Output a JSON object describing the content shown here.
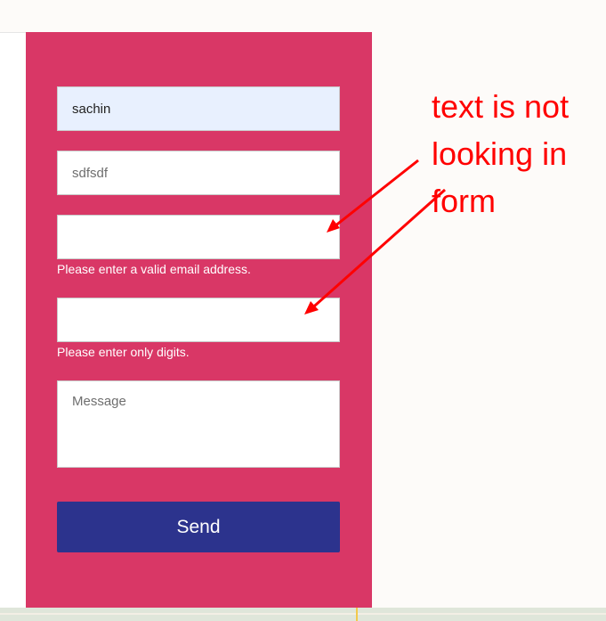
{
  "form": {
    "name_value": "sachin",
    "second_value": "sdfsdf",
    "email_value": "",
    "email_error": "Please enter a valid email address.",
    "phone_value": "",
    "phone_error": "Please enter only digits.",
    "message_placeholder": "Message",
    "send_label": "Send"
  },
  "annotation": {
    "line1": "text is not",
    "line2": "looking in",
    "line3": "form"
  },
  "colors": {
    "panel": "#d93766",
    "button": "#2c338d",
    "annotation": "#ff0000",
    "autofill": "#e8f0fe"
  }
}
